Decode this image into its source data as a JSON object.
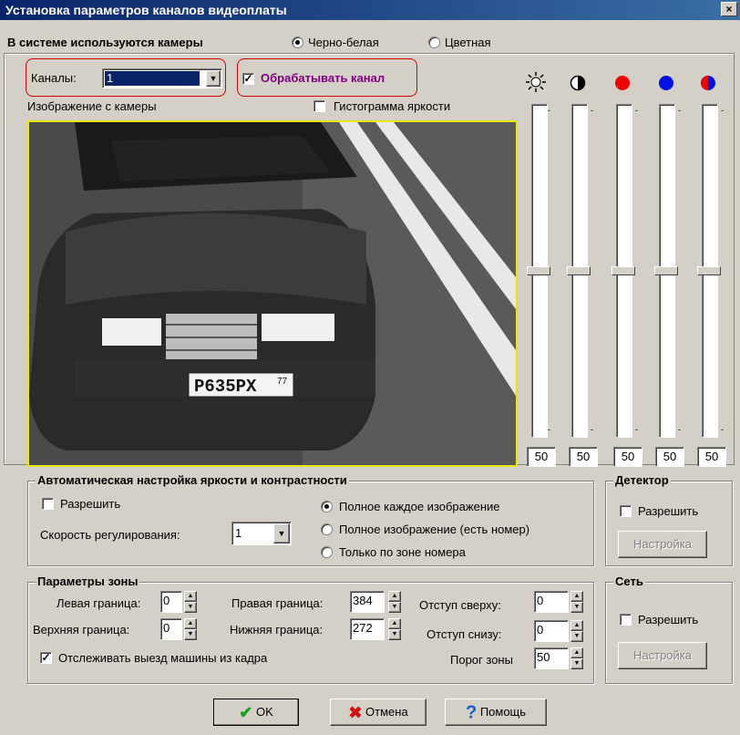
{
  "window": {
    "title": "Установка параметров каналов видеоплаты",
    "close": "×"
  },
  "system": {
    "label": "В системе используются камеры",
    "mode_bw": "Черно-белая",
    "mode_color": "Цветная",
    "selected": "bw"
  },
  "channel": {
    "label": "Каналы:",
    "value": "1",
    "process_label": "Обрабатывать канал",
    "process_checked": true
  },
  "image": {
    "label": "Изображение с камеры",
    "histogram_label": "Гистограмма яркости",
    "histogram_checked": false,
    "plate_text": "P635PX",
    "plate_region": "77"
  },
  "sliders": [
    {
      "icon": "brightness-icon",
      "value": "50"
    },
    {
      "icon": "contrast-icon",
      "value": "50"
    },
    {
      "icon": "red-channel-icon",
      "value": "50"
    },
    {
      "icon": "blue-channel-icon",
      "value": "50"
    },
    {
      "icon": "color-balance-icon",
      "value": "50"
    }
  ],
  "auto": {
    "title": "Автоматическая настройка яркости и контрастности",
    "enable": "Разрешить",
    "speed_label": "Скорость регулирования:",
    "speed_value": "1",
    "opt1": "Полное каждое изображение",
    "opt2": "Полное изображение (есть номер)",
    "opt3": "Только по зоне номера"
  },
  "detector": {
    "title": "Детектор",
    "enable": "Разрешить",
    "settings": "Настройка"
  },
  "network": {
    "title": "Сеть",
    "enable": "Разрешить",
    "settings": "Настройка"
  },
  "zone": {
    "title": "Параметры зоны",
    "left_label": "Левая граница:",
    "left": "0",
    "top_label": "Верхняя граница:",
    "top": "0",
    "right_label": "Правая граница:",
    "right": "384",
    "bottom_label": "Нижняя граница:",
    "bottom": "272",
    "off_top_label": "Отступ сверху:",
    "off_top": "0",
    "off_bottom_label": "Отступ снизу:",
    "off_bottom": "0",
    "threshold_label": "Порог зоны",
    "threshold": "50",
    "track_label": "Отслеживать выезд машины из кадра",
    "track_checked": true
  },
  "buttons": {
    "ok": "OK",
    "cancel": "Отмена",
    "help": "Помощь"
  }
}
